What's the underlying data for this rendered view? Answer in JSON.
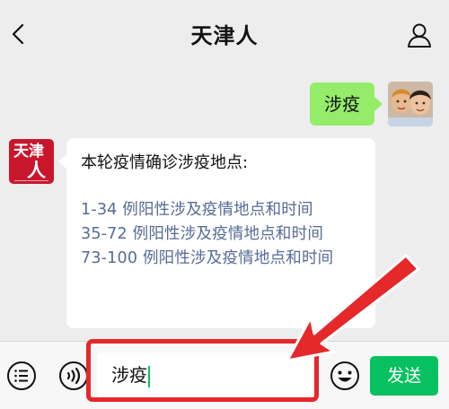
{
  "header": {
    "title": "天津人"
  },
  "messages": {
    "outgoing_text": "涉疫",
    "incoming_heading": "本轮疫情确诊涉疫地点:",
    "incoming_links": [
      "1-34 例阳性涉及疫情地点和时间",
      "35-72 例阳性涉及疫情地点和时间",
      "73-100 例阳性涉及疫情地点和时间"
    ],
    "bot_avatar_text": [
      "天津",
      "人"
    ]
  },
  "input": {
    "value": "涉疫",
    "send_label": "发送"
  },
  "colors": {
    "outgoing_bubble": "#95ec69",
    "link": "#576b95",
    "send_button": "#07c160",
    "annotation": "#e5282a",
    "bot_avatar": "#c8172c"
  },
  "icons": [
    "back-icon",
    "profile-icon",
    "menu-icon",
    "voice-icon",
    "emoji-icon",
    "arrow-annotation-icon"
  ]
}
